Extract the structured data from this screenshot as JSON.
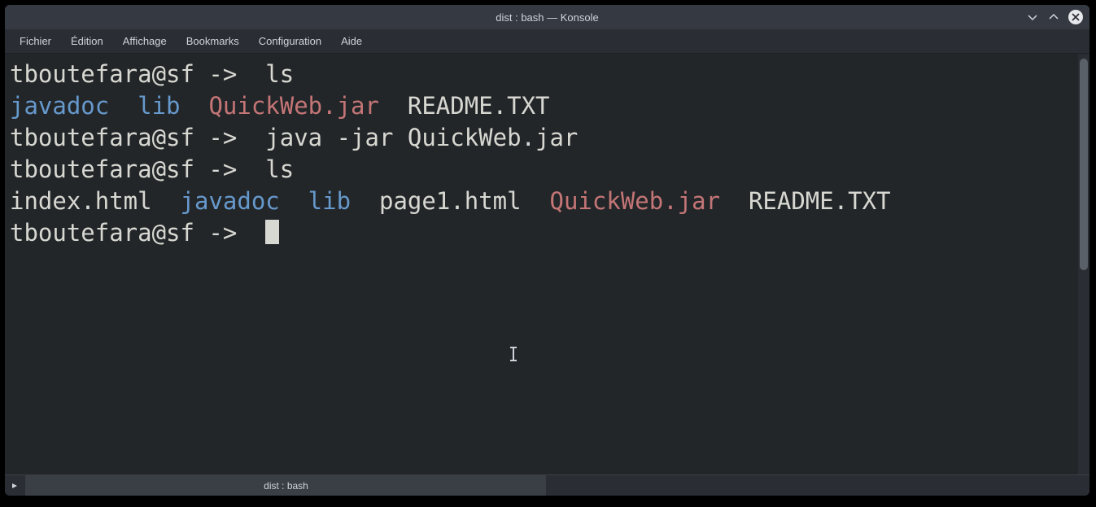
{
  "window": {
    "title": "dist : bash — Konsole"
  },
  "menubar": {
    "items": [
      "Fichier",
      "Édition",
      "Affichage",
      "Bookmarks",
      "Configuration",
      "Aide"
    ]
  },
  "statusbar": {
    "tab_label": "dist : bash"
  },
  "terminal": {
    "prompt": "tboutefara@sf -> ",
    "lines": [
      {
        "type": "cmd",
        "command": " ls"
      },
      {
        "type": "ls",
        "entries": [
          {
            "name": "javadoc",
            "kind": "dir"
          },
          {
            "name": "lib",
            "kind": "dir"
          },
          {
            "name": "QuickWeb.jar",
            "kind": "exec"
          },
          {
            "name": "README.TXT",
            "kind": "txt"
          }
        ]
      },
      {
        "type": "cmd",
        "command": " java -jar QuickWeb.jar"
      },
      {
        "type": "cmd",
        "command": " ls"
      },
      {
        "type": "ls",
        "entries": [
          {
            "name": "index.html",
            "kind": "txt"
          },
          {
            "name": "javadoc",
            "kind": "dir"
          },
          {
            "name": "lib",
            "kind": "dir"
          },
          {
            "name": "page1.html",
            "kind": "txt"
          },
          {
            "name": "QuickWeb.jar",
            "kind": "exec"
          },
          {
            "name": "README.TXT",
            "kind": "txt"
          }
        ]
      },
      {
        "type": "prompt"
      }
    ]
  }
}
